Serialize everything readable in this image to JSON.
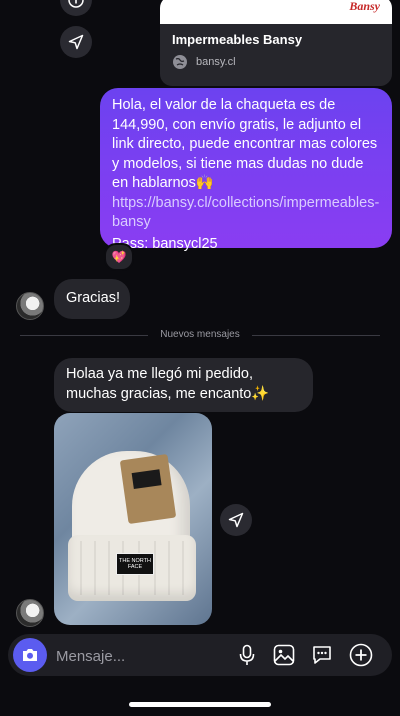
{
  "link_preview": {
    "brand_text": "Bansy",
    "title": "Impermeables Bansy",
    "domain": "bansy.cl"
  },
  "sent_message": {
    "text": "Hola, el valor de la chaqueta es de 144,990, con envío gratis, le adjunto el link directo, puede encontrar mas colores y modelos, si tiene mas dudas no dude en hablarnos🙌",
    "link": "https://bansy.cl/collections/impermeables-bansy",
    "pass": "Pass: bansycl25",
    "reaction": "💖"
  },
  "received_1": {
    "text": "Gracias!"
  },
  "divider": {
    "label": "Nuevos mensajes"
  },
  "received_2": {
    "text": "Holaa ya me llegó mi pedido, muchas gracias, me encanto✨"
  },
  "photo": {
    "patch_text": "THE NORTH FACE"
  },
  "composer": {
    "placeholder": "Mensaje..."
  },
  "icons": [
    "info-icon",
    "share-icon",
    "globe-icon",
    "camera-icon",
    "microphone-icon",
    "gallery-icon",
    "sticker-icon",
    "plus-icon"
  ],
  "colors": {
    "bubble_sent_start": "#6c42f0",
    "bubble_sent_end": "#8a3df2",
    "bubble_received": "#26262c",
    "background": "#0b0b0f",
    "camera_button": "#5b5cf0"
  }
}
